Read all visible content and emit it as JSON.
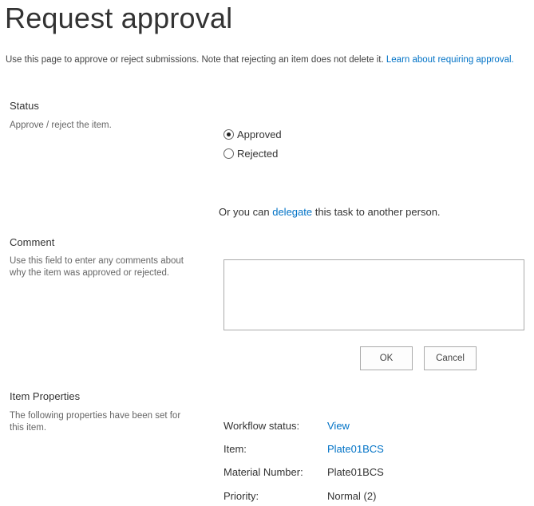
{
  "page": {
    "title": "Request approval",
    "intro_text": "Use this page to approve or reject submissions. Note that rejecting an item does not delete it.",
    "intro_link": "Learn about requiring approval."
  },
  "status": {
    "title": "Status",
    "description": "Approve / reject the item.",
    "options": [
      {
        "label": "Approved",
        "checked": true
      },
      {
        "label": "Rejected",
        "checked": false
      }
    ],
    "delegate_prefix": "Or you can",
    "delegate_link": "delegate",
    "delegate_suffix": "this task to another person."
  },
  "comment": {
    "title": "Comment",
    "description": "Use this field to enter any comments about why the item was approved or rejected.",
    "value": ""
  },
  "buttons": {
    "ok": "OK",
    "cancel": "Cancel"
  },
  "item_properties": {
    "title": "Item Properties",
    "description": "The following properties have been set for this item.",
    "rows": [
      {
        "label": "Workflow status:",
        "value": "View",
        "is_link": true
      },
      {
        "label": "Item:",
        "value": "Plate01BCS",
        "is_link": true
      },
      {
        "label": "Material Number:",
        "value": "Plate01BCS",
        "is_link": false
      },
      {
        "label": "Priority:",
        "value": "Normal (2)",
        "is_link": false
      }
    ]
  }
}
